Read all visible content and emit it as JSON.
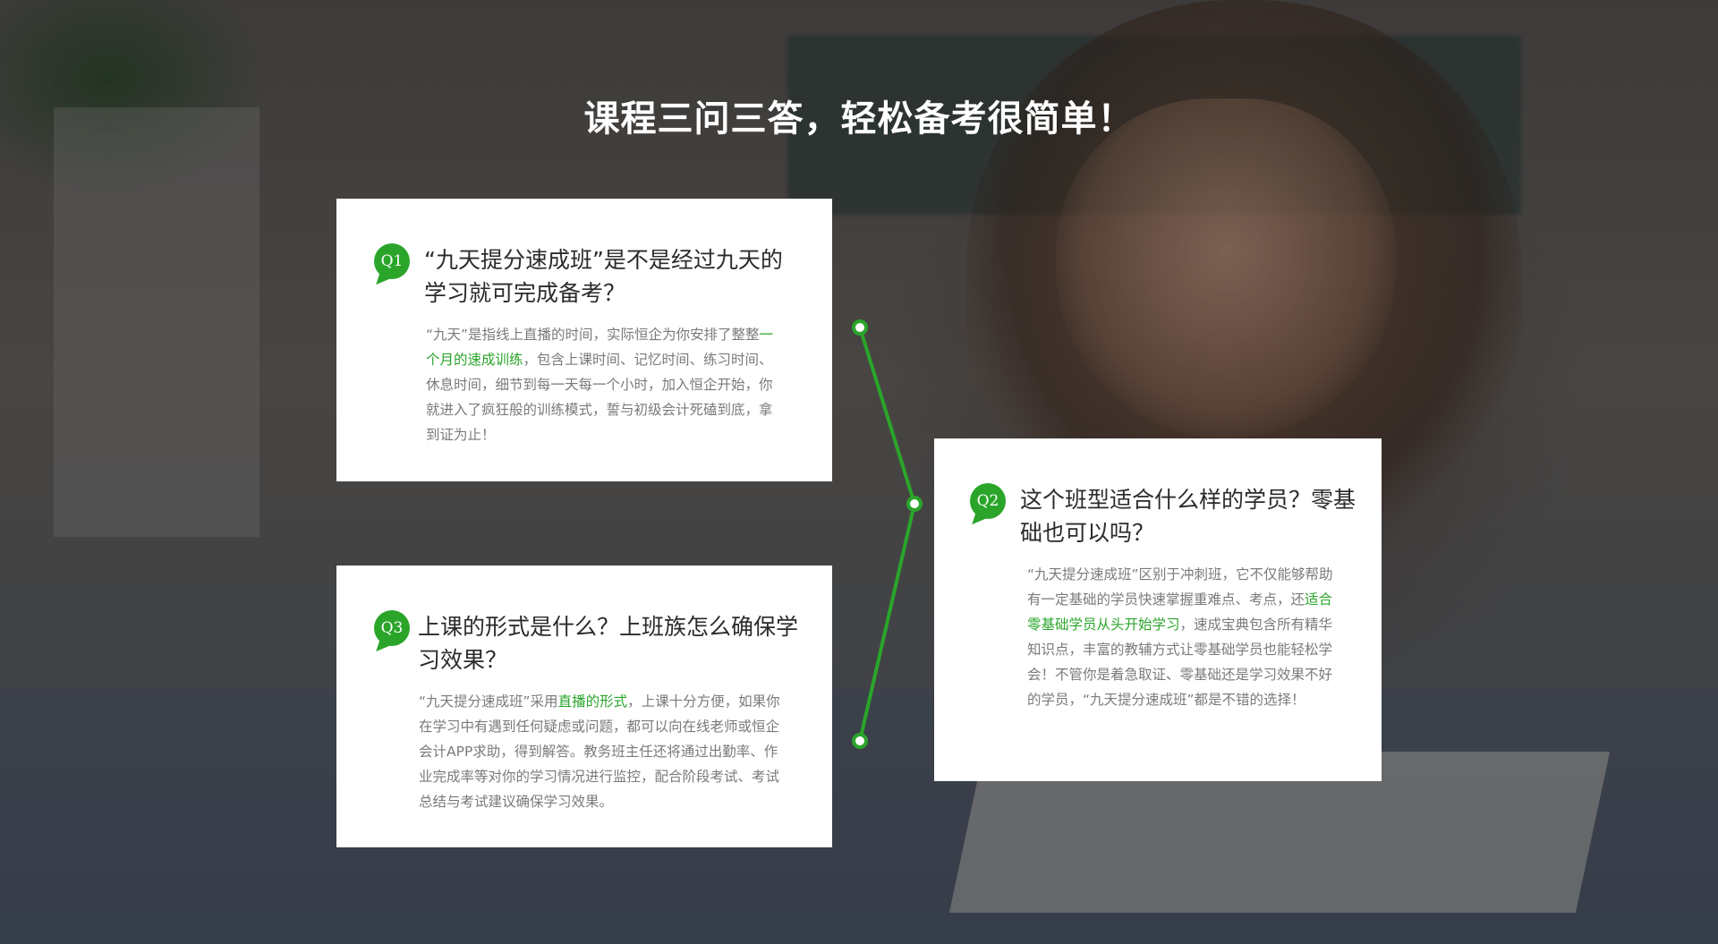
{
  "page": {
    "title": "课程三问三答，轻松备考很简单！"
  },
  "colors": {
    "accent": "#2aa52a",
    "card_bg": "#ffffff",
    "question_text": "#2b2b2b",
    "answer_text": "#7a7a7a"
  },
  "qa": [
    {
      "badge": "Q1",
      "question": "“九天提分速成班”是不是经过九天的学习就可完成备考？",
      "answer_parts": [
        "“九天”是指线上直播的时间，实际恒企为你安排了整整",
        "一个月的速成训练",
        "，包含上课时间、记忆时间、练习时间、休息时间，细节到每一天每一个小时，加入恒企开始，你就进入了疯狂般的训练模式，誓与初级会计死磕到底，拿到证为止！"
      ]
    },
    {
      "badge": "Q2",
      "question": "这个班型适合什么样的学员？零基础也可以吗？",
      "answer_parts": [
        "“九天提分速成班”区别于冲刺班，它不仅能够帮助有一定基础的学员快速掌握重难点、考点，还",
        "适合零基础学员从头开始学习",
        "，速成宝典包含所有精华知识点，丰富的教辅方式让零基础学员也能轻松学会！不管你是着急取证、零基础还是学习效果不好的学员，“九天提分速成班”都是不错的选择！"
      ]
    },
    {
      "badge": "Q3",
      "question": "上课的形式是什么？上班族怎么确保学习效果？",
      "answer_parts": [
        "“九天提分速成班”采用",
        "直播的形式",
        "，上课十分方便，如果你在学习中有遇到任何疑虑或问题，都可以向在线老师或恒企会计APP求助，得到解答。教务班主任还将通过出勤率、作业完成率等对你的学习情况进行监控，配合阶段考试、考试总结与考试建议确保学习效果。"
      ]
    }
  ]
}
